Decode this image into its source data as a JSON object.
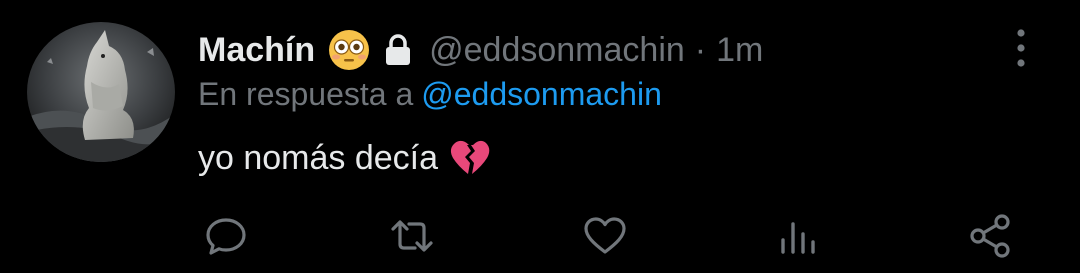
{
  "tweet": {
    "display_name": "Machín",
    "name_emoji": "flushed-face-emoji",
    "handle": "@eddsonmachin",
    "separator": "·",
    "time": "1m",
    "reply_prefix": "En respuesta a",
    "reply_mention": "@eddsonmachin",
    "text": "yo nomás decía",
    "text_emoji": "broken-heart-emoji"
  },
  "actions": [
    {
      "name": "reply",
      "icon": "comment-icon"
    },
    {
      "name": "retweet",
      "icon": "retweet-icon"
    },
    {
      "name": "like",
      "icon": "heart-icon"
    },
    {
      "name": "analytics",
      "icon": "analytics-icon"
    },
    {
      "name": "share",
      "icon": "share-icon"
    }
  ],
  "colors": {
    "background": "#000000",
    "primary_text": "#e7e9ea",
    "secondary_text": "#71767b",
    "link": "#1d9bf0",
    "icon": "#71767b"
  }
}
